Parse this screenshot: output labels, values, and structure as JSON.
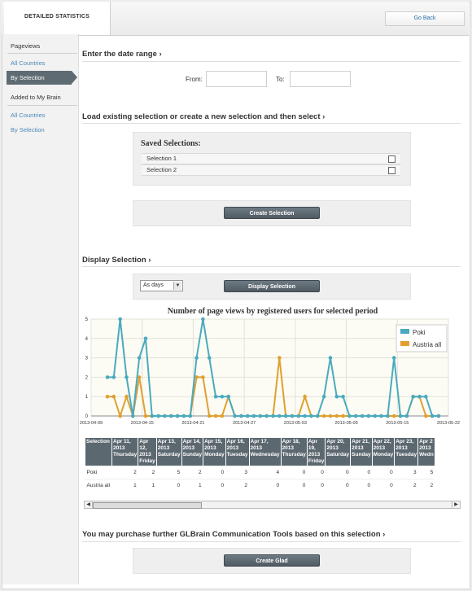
{
  "header": {
    "title": "DETAILED STATISTICS",
    "go_back": "Go Back"
  },
  "sidebar": {
    "pageviews_heading": "Pageviews",
    "pageviews_items": [
      "All Countries",
      "By Selection"
    ],
    "brain_heading": "Added to My Brain",
    "brain_items": [
      "All Countries",
      "By Selection"
    ]
  },
  "date_range": {
    "title": "Enter the date range ›",
    "from_label": "From:",
    "to_label": "To:",
    "from_value": "",
    "to_value": ""
  },
  "selection": {
    "title": "Load existing selection or create a new selection and then select ›",
    "saved_heading": "Saved Selections:",
    "items": [
      "Selection 1",
      "Selection 2"
    ],
    "create_button": "Create Selection"
  },
  "display": {
    "title": "Display Selection ›",
    "select_value": "As days",
    "button": "Display Selection"
  },
  "chart_data": {
    "type": "line",
    "title": "Number of page views by registered users for selected period",
    "ylim": [
      0,
      5
    ],
    "yticks": [
      0,
      1,
      2,
      3,
      4,
      5
    ],
    "xtick_labels": [
      "2013-04-09",
      "2013-04-15",
      "2013-04-21",
      "2013-04-27",
      "2013-05-03",
      "2013-05-09",
      "2013-05-15",
      "2013-05-22"
    ],
    "legend_position": "top-right",
    "grid": true,
    "series": [
      {
        "name": "Poki",
        "color": "#4aaabf",
        "values": [
          2,
          2,
          5,
          2,
          0,
          3,
          4,
          0,
          0,
          0,
          0,
          0,
          0,
          0,
          3,
          5,
          3,
          1,
          1,
          1,
          0,
          0,
          0,
          0,
          0,
          0,
          0,
          0,
          0,
          0,
          0,
          0,
          0,
          0,
          1,
          3,
          1,
          1,
          0,
          0,
          0,
          0,
          0,
          0,
          0,
          3,
          0,
          0,
          1,
          1,
          1,
          0,
          0
        ]
      },
      {
        "name": "Austria all",
        "color": "#e0a030",
        "values": [
          1,
          1,
          0,
          1,
          0,
          2,
          0,
          0,
          0,
          0,
          0,
          0,
          0,
          0,
          2,
          2,
          0,
          0,
          0,
          1,
          0,
          0,
          0,
          0,
          0,
          0,
          0,
          3,
          0,
          0,
          0,
          1,
          0,
          0,
          0,
          0,
          0,
          0,
          0,
          0,
          0,
          0,
          0,
          0,
          0,
          0,
          0,
          0,
          1,
          1,
          0,
          0,
          0
        ]
      }
    ]
  },
  "table": {
    "first_header": "Selection",
    "columns": [
      [
        "Apr 11,",
        "2013",
        "Thursday"
      ],
      [
        "Apr",
        "12,",
        "2013",
        "Friday"
      ],
      [
        "Apr 13,",
        "2013",
        "Saturday"
      ],
      [
        "Apr 14,",
        "2013",
        "Sunday"
      ],
      [
        "Apr 15,",
        "2013",
        "Monday"
      ],
      [
        "Apr 16,",
        "2013",
        "Tuesday"
      ],
      [
        "Apr 17,",
        "2013",
        "Wednesday"
      ],
      [
        "Apr 18,",
        "2013",
        "Thursday"
      ],
      [
        "Apr",
        "19,",
        "2013",
        "Friday"
      ],
      [
        "Apr 20,",
        "2013",
        "Saturday"
      ],
      [
        "Apr 21,",
        "2013",
        "Sunday"
      ],
      [
        "Apr 22,",
        "2013",
        "Monday"
      ],
      [
        "Apr 23,",
        "2013",
        "Tuesday"
      ],
      [
        "Apr 2",
        "2013",
        "Wedn"
      ]
    ],
    "rows": [
      {
        "label": "Poki",
        "values": [
          "2",
          "2",
          "5",
          "2",
          "0",
          "3",
          "4",
          "0",
          "0",
          "0",
          "0",
          "0",
          "3",
          "5"
        ]
      },
      {
        "label": "Austria all",
        "values": [
          "1",
          "1",
          "0",
          "1",
          "0",
          "2",
          "0",
          "0",
          "0",
          "0",
          "0",
          "0",
          "2",
          "2"
        ]
      }
    ]
  },
  "purchase": {
    "title": "You may purchase further GLBrain Communication Tools based on this selection ›",
    "button": "Create Glad"
  }
}
